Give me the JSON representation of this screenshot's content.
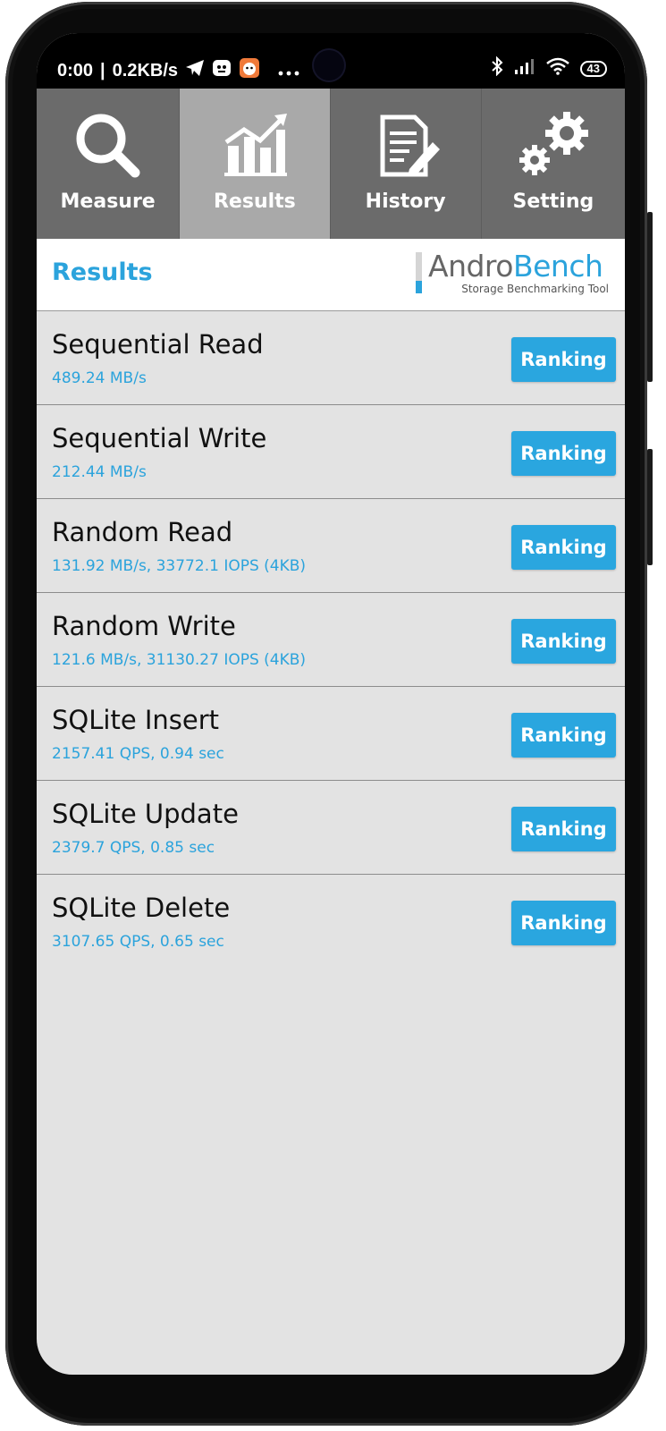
{
  "status_bar": {
    "time": "0:00",
    "speed": "0.2KB/s",
    "battery": "43",
    "icons": [
      "telegram-icon",
      "app-icon",
      "cat-icon",
      "more-dots-icon",
      "bluetooth-icon",
      "signal-icon",
      "wifi-icon",
      "battery-icon"
    ]
  },
  "tabs": [
    {
      "label": "Measure",
      "icon": "magnifier-icon",
      "active": false
    },
    {
      "label": "Results",
      "icon": "chart-icon",
      "active": true
    },
    {
      "label": "History",
      "icon": "document-icon",
      "active": false
    },
    {
      "label": "Setting",
      "icon": "gears-icon",
      "active": false
    }
  ],
  "header": {
    "title": "Results",
    "logo_part1": "Andro",
    "logo_part2": "Bench",
    "logo_subtitle": "Storage Benchmarking Tool"
  },
  "results": [
    {
      "name": "Sequential Read",
      "value": "489.24 MB/s",
      "button": "Ranking"
    },
    {
      "name": "Sequential Write",
      "value": "212.44 MB/s",
      "button": "Ranking"
    },
    {
      "name": "Random Read",
      "value": "131.92 MB/s, 33772.1 IOPS (4KB)",
      "button": "Ranking"
    },
    {
      "name": "Random Write",
      "value": "121.6 MB/s, 31130.27 IOPS (4KB)",
      "button": "Ranking"
    },
    {
      "name": "SQLite Insert",
      "value": "2157.41 QPS, 0.94 sec",
      "button": "Ranking"
    },
    {
      "name": "SQLite Update",
      "value": "2379.7 QPS, 0.85 sec",
      "button": "Ranking"
    },
    {
      "name": "SQLite Delete",
      "value": "3107.65 QPS, 0.65 sec",
      "button": "Ranking"
    }
  ],
  "colors": {
    "accent": "#2ba3dc",
    "tab_bg": "#6b6b6b",
    "tab_active_bg": "#a9a9a9",
    "list_bg": "#e3e3e3"
  }
}
